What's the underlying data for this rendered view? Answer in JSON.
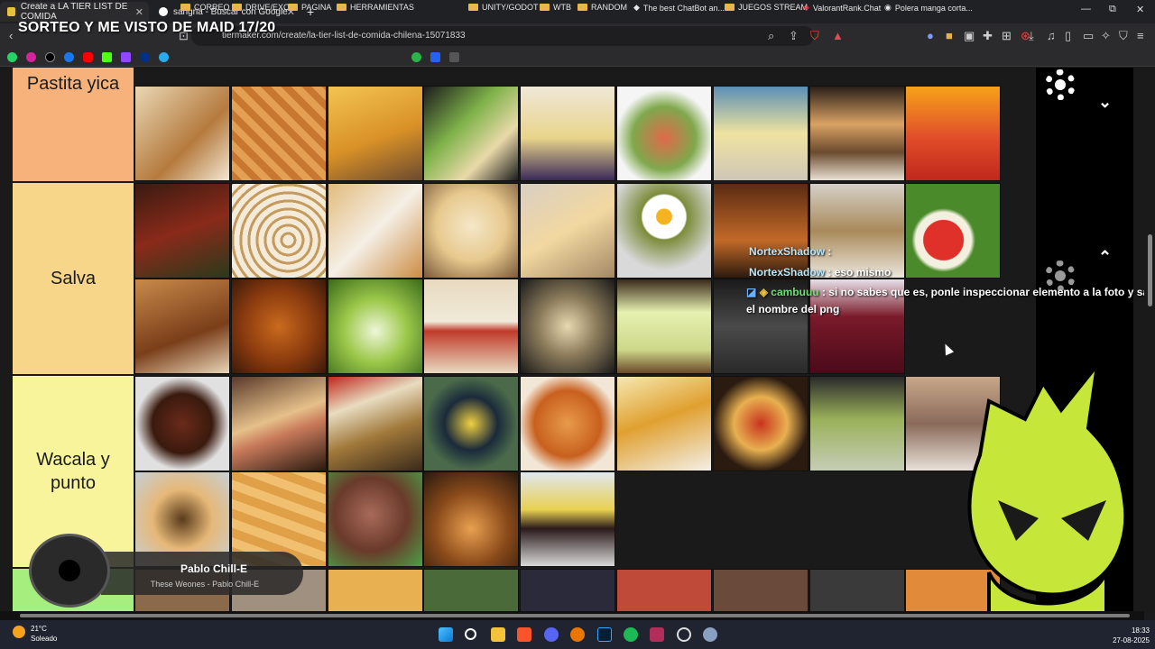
{
  "tabs": [
    {
      "label": "Create a LA TIER LIST DE COMIDA",
      "active": true
    },
    {
      "label": "sangria - Buscar con Google",
      "active": false
    }
  ],
  "new_tab": "+",
  "window_controls": {
    "minimize": "—",
    "maximize": "⧉",
    "close": "✕"
  },
  "overlay_title": "SORTEO Y ME VISTO DE MAID 17/20",
  "address_bar": {
    "url": "tiermaker.com/create/la-tier-list-de-comida-chilena-15071833"
  },
  "bookmarks": [
    {
      "label": "CORREO"
    },
    {
      "label": "DRIVE/EXC"
    },
    {
      "label": "PAGINA"
    },
    {
      "label": "HERRAMIENTAS"
    },
    {
      "label": "UNITY/GODOT"
    },
    {
      "label": "WTB"
    },
    {
      "label": "RANDOM"
    },
    {
      "label": "The best ChatBot an..."
    },
    {
      "label": "JUEGOS STREAM"
    },
    {
      "label": "ValorantRank.Chat"
    },
    {
      "label": "Polera manga corta..."
    }
  ],
  "tiers": [
    {
      "label": "Pastita yica",
      "color": "#f6b27a"
    },
    {
      "label": "Salva",
      "color": "#f7d68a"
    },
    {
      "label": "Wacala y punto",
      "color": "#f7f49b"
    }
  ],
  "chat": [
    {
      "user": "NortexShadow",
      "text": ":"
    },
    {
      "user": "NortexShadow",
      "text": ": eso mismo"
    },
    {
      "user": "cambuuu",
      "text": ": si no sabes que es, ponle inspeccionar elemento a la foto y sale",
      "text2": "el nombre del png"
    }
  ],
  "music": {
    "title": "Pablo Chill-E",
    "subtitle": "These Weones - Pablo Chill-E"
  },
  "weather": {
    "temp": "21°C",
    "condition": "Soleado"
  },
  "clock": {
    "time": "18:33",
    "date": "27-08-2025"
  }
}
